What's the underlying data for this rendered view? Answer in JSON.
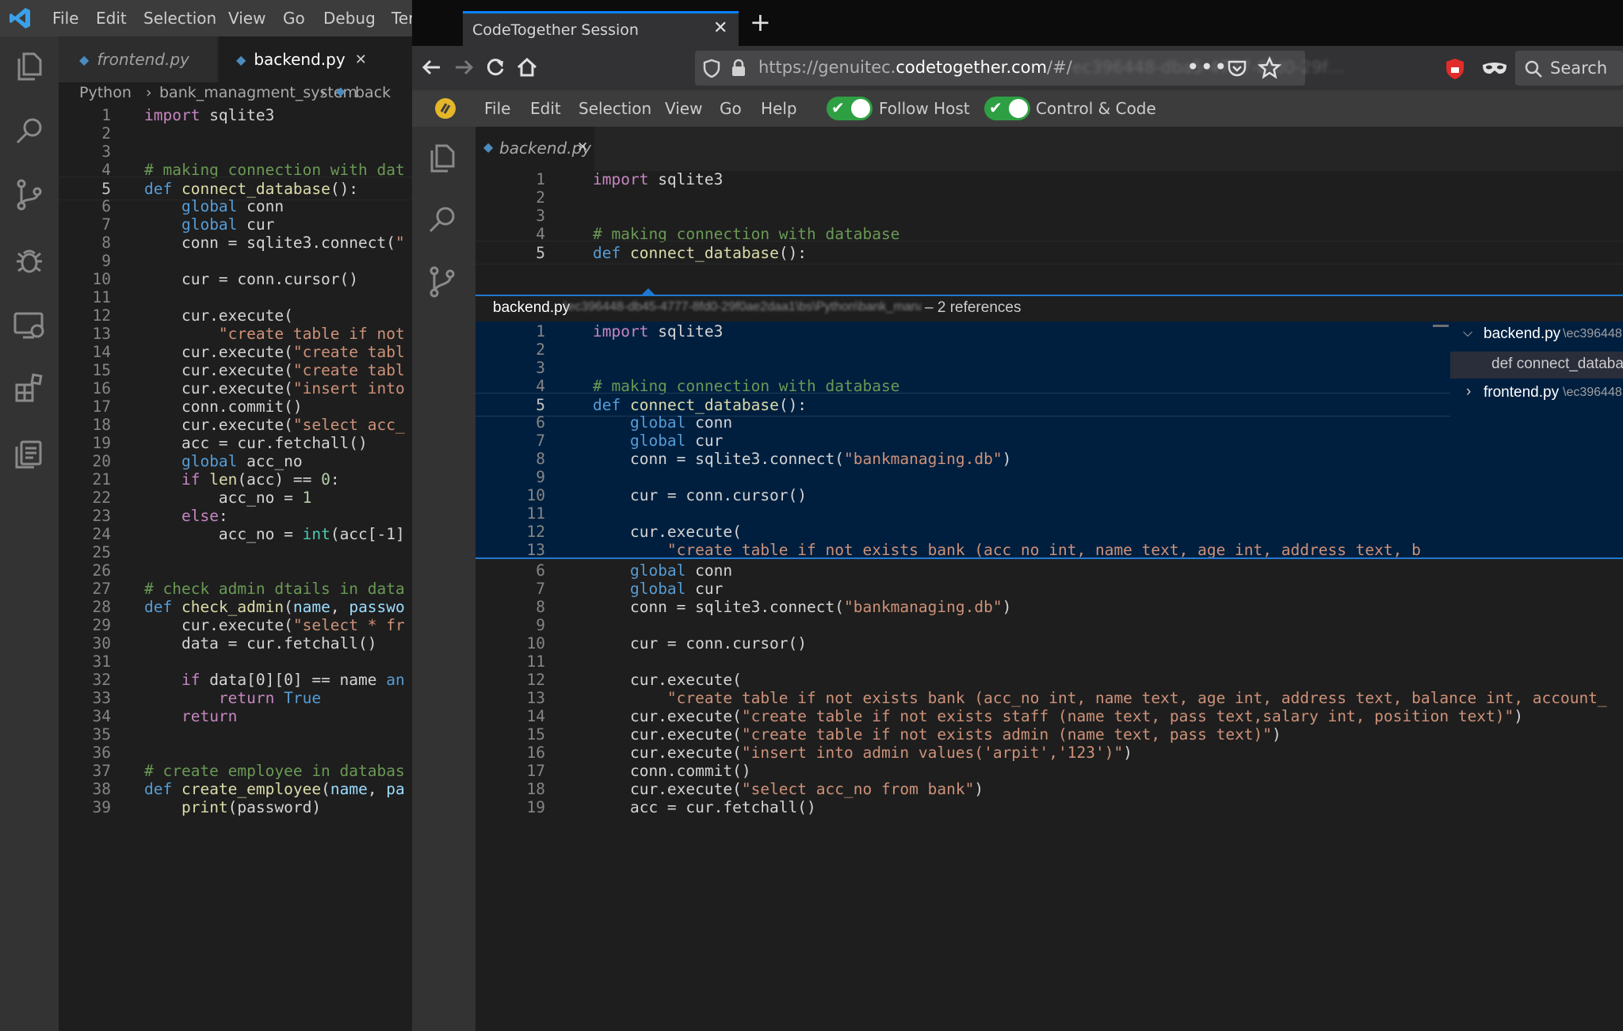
{
  "vscode": {
    "menu": [
      "File",
      "Edit",
      "Selection",
      "View",
      "Go",
      "Debug",
      "Ter"
    ],
    "tabs": [
      {
        "label": "frontend.py"
      },
      {
        "label": "backend.py"
      }
    ],
    "close_glyph": "✕",
    "breadcrumb": [
      "Python",
      "bank_managment_system",
      "back"
    ],
    "breadcrumb_sep": "›",
    "icons": [
      "files-icon",
      "search-icon",
      "source-control-icon",
      "debug-icon",
      "remote-explorer-icon",
      "extensions-icon",
      "codetogether-icon"
    ],
    "code": [
      {
        "n": "1",
        "t": [
          [
            "kc",
            "import"
          ],
          [
            "pl",
            " sqlite3"
          ]
        ]
      },
      {
        "n": "2",
        "t": []
      },
      {
        "n": "3",
        "t": []
      },
      {
        "n": "4",
        "t": [
          [
            "cm",
            "# making connection with dat"
          ]
        ]
      },
      {
        "n": "5",
        "t": [
          [
            "kw",
            "def"
          ],
          [
            "pl",
            " "
          ],
          [
            "fn",
            "connect_database"
          ],
          [
            "pl",
            "():"
          ]
        ],
        "cur": true
      },
      {
        "n": "6",
        "t": [
          [
            "pl",
            "    "
          ],
          [
            "kw",
            "global"
          ],
          [
            "pl",
            " conn"
          ]
        ]
      },
      {
        "n": "7",
        "t": [
          [
            "pl",
            "    "
          ],
          [
            "kw",
            "global"
          ],
          [
            "pl",
            " cur"
          ]
        ]
      },
      {
        "n": "8",
        "t": [
          [
            "pl",
            "    conn = sqlite3.connect("
          ],
          [
            "st",
            "\""
          ]
        ]
      },
      {
        "n": "9",
        "t": []
      },
      {
        "n": "10",
        "t": [
          [
            "pl",
            "    cur = conn.cursor()"
          ]
        ]
      },
      {
        "n": "11",
        "t": []
      },
      {
        "n": "12",
        "t": [
          [
            "pl",
            "    cur.execute("
          ]
        ]
      },
      {
        "n": "13",
        "t": [
          [
            "pl",
            "        "
          ],
          [
            "st",
            "\"create table if not"
          ]
        ]
      },
      {
        "n": "14",
        "t": [
          [
            "pl",
            "    cur.execute("
          ],
          [
            "st",
            "\"create tabl"
          ]
        ]
      },
      {
        "n": "15",
        "t": [
          [
            "pl",
            "    cur.execute("
          ],
          [
            "st",
            "\"create tabl"
          ]
        ]
      },
      {
        "n": "16",
        "t": [
          [
            "pl",
            "    cur.execute("
          ],
          [
            "st",
            "\"insert into"
          ]
        ]
      },
      {
        "n": "17",
        "t": [
          [
            "pl",
            "    conn.commit()"
          ]
        ]
      },
      {
        "n": "18",
        "t": [
          [
            "pl",
            "    cur.execute("
          ],
          [
            "st",
            "\"select acc_"
          ]
        ]
      },
      {
        "n": "19",
        "t": [
          [
            "pl",
            "    acc = cur.fetchall()"
          ]
        ]
      },
      {
        "n": "20",
        "t": [
          [
            "pl",
            "    "
          ],
          [
            "kw",
            "global"
          ],
          [
            "pl",
            " acc_no"
          ]
        ]
      },
      {
        "n": "21",
        "t": [
          [
            "pl",
            "    "
          ],
          [
            "kc",
            "if"
          ],
          [
            "pl",
            " "
          ],
          [
            "fn",
            "len"
          ],
          [
            "pl",
            "(acc) == "
          ],
          [
            "nm",
            "0"
          ],
          [
            "pl",
            ":"
          ]
        ]
      },
      {
        "n": "22",
        "t": [
          [
            "pl",
            "        acc_no = "
          ],
          [
            "nm",
            "1"
          ]
        ]
      },
      {
        "n": "23",
        "t": [
          [
            "pl",
            "    "
          ],
          [
            "kc",
            "else"
          ],
          [
            "pl",
            ":"
          ]
        ]
      },
      {
        "n": "24",
        "t": [
          [
            "pl",
            "        acc_no = "
          ],
          [
            "bi",
            "int"
          ],
          [
            "pl",
            "(acc[-1]"
          ]
        ]
      },
      {
        "n": "25",
        "t": []
      },
      {
        "n": "26",
        "t": []
      },
      {
        "n": "27",
        "t": [
          [
            "cm",
            "# check admin dtails in data"
          ]
        ]
      },
      {
        "n": "28",
        "t": [
          [
            "kw",
            "def"
          ],
          [
            "pl",
            " "
          ],
          [
            "fn",
            "check_admin"
          ],
          [
            "pl",
            "("
          ],
          [
            "pr",
            "name"
          ],
          [
            "pl",
            ", "
          ],
          [
            "pr",
            "passwo"
          ]
        ]
      },
      {
        "n": "29",
        "t": [
          [
            "pl",
            "    cur.execute("
          ],
          [
            "st",
            "\"select * fr"
          ]
        ]
      },
      {
        "n": "30",
        "t": [
          [
            "pl",
            "    data = cur.fetchall()"
          ]
        ]
      },
      {
        "n": "31",
        "t": []
      },
      {
        "n": "32",
        "t": [
          [
            "pl",
            "    "
          ],
          [
            "kc",
            "if"
          ],
          [
            "pl",
            " data[0][0] == name "
          ],
          [
            "kw",
            "an"
          ]
        ]
      },
      {
        "n": "33",
        "t": [
          [
            "pl",
            "        "
          ],
          [
            "kc",
            "return"
          ],
          [
            "pl",
            " "
          ],
          [
            "kw",
            "True"
          ]
        ]
      },
      {
        "n": "34",
        "t": [
          [
            "pl",
            "    "
          ],
          [
            "kc",
            "return"
          ]
        ]
      },
      {
        "n": "35",
        "t": []
      },
      {
        "n": "36",
        "t": []
      },
      {
        "n": "37",
        "t": [
          [
            "cm",
            "# create employee in databas"
          ]
        ]
      },
      {
        "n": "38",
        "t": [
          [
            "kw",
            "def"
          ],
          [
            "pl",
            " "
          ],
          [
            "fn",
            "create_employee"
          ],
          [
            "pl",
            "("
          ],
          [
            "pr",
            "name"
          ],
          [
            "pl",
            ", "
          ],
          [
            "pr",
            "pa"
          ]
        ]
      },
      {
        "n": "39",
        "t": [
          [
            "pl",
            "    "
          ],
          [
            "fn",
            "print"
          ],
          [
            "pl",
            "(password)"
          ]
        ]
      }
    ]
  },
  "browser": {
    "tab_title": "CodeTogether Session",
    "url_prefix": "https://genuitec.",
    "url_domain": "codetogether.com",
    "url_path": "/#/",
    "url_hidden": "ec396448-dba5-4777-8fd0-29f…",
    "search_placeholder": "Search",
    "new_tab": "+"
  },
  "app": {
    "menu": [
      "File",
      "Edit",
      "Selection",
      "View",
      "Go",
      "Help"
    ],
    "toggles": [
      {
        "label": "Follow Host",
        "on": true
      },
      {
        "label": "Control & Code",
        "on": true
      }
    ],
    "tab": {
      "label": "backend.py"
    },
    "top_code": [
      {
        "n": "1",
        "t": [
          [
            "kc",
            "import"
          ],
          [
            "pl",
            " sqlite3"
          ]
        ]
      },
      {
        "n": "2",
        "t": []
      },
      {
        "n": "3",
        "t": []
      },
      {
        "n": "4",
        "t": [
          [
            "cm",
            "# making connection with database"
          ]
        ]
      },
      {
        "n": "5",
        "t": [
          [
            "kw",
            "def"
          ],
          [
            "pl",
            " "
          ],
          [
            "fn",
            "connect_database"
          ],
          [
            "pl",
            "():"
          ]
        ],
        "cur": true
      }
    ],
    "peek": {
      "file": "backend.py",
      "path": "\\ec396448-db45-4777-8fd0-29f0ae2daa1\\bs\\Python\\bank_managment_system",
      "refs": "– 2 references",
      "tree": [
        {
          "label": "backend.py",
          "detail": "\\ec396448",
          "expanded": true
        },
        {
          "label": "def connect_databa",
          "child": true
        },
        {
          "label": "frontend.py",
          "detail": "\\ec396448",
          "expanded": false
        }
      ],
      "code": [
        {
          "n": "1",
          "t": [
            [
              "kc",
              "import"
            ],
            [
              "pl",
              " sqlite3"
            ]
          ]
        },
        {
          "n": "2",
          "t": []
        },
        {
          "n": "3",
          "t": []
        },
        {
          "n": "4",
          "t": [
            [
              "cm",
              "# making connection with database"
            ]
          ]
        },
        {
          "n": "5",
          "t": [
            [
              "kw",
              "def"
            ],
            [
              "pl",
              " "
            ],
            [
              "fn",
              "connect_database"
            ],
            [
              "pl",
              "():"
            ]
          ],
          "cur": true
        },
        {
          "n": "6",
          "t": [
            [
              "pl",
              "    "
            ],
            [
              "kw",
              "global"
            ],
            [
              "pl",
              " conn"
            ]
          ]
        },
        {
          "n": "7",
          "t": [
            [
              "pl",
              "    "
            ],
            [
              "kw",
              "global"
            ],
            [
              "pl",
              " cur"
            ]
          ]
        },
        {
          "n": "8",
          "t": [
            [
              "pl",
              "    conn = sqlite3.connect("
            ],
            [
              "st",
              "\"bankmanaging.db\""
            ],
            [
              "pl",
              ")"
            ]
          ]
        },
        {
          "n": "9",
          "t": []
        },
        {
          "n": "10",
          "t": [
            [
              "pl",
              "    cur = conn.cursor()"
            ]
          ]
        },
        {
          "n": "11",
          "t": []
        },
        {
          "n": "12",
          "t": [
            [
              "pl",
              "    cur.execute("
            ]
          ]
        },
        {
          "n": "13",
          "t": [
            [
              "pl",
              "        "
            ],
            [
              "st",
              "\"create table if not exists bank (acc_no int, name text, age int, address text, b"
            ]
          ]
        },
        {
          "n": "14",
          "t": [
            [
              "pl",
              "    cur.execute("
            ],
            [
              "st",
              "\"create table if not exists staff (name text, pass text,salary int, posit"
            ]
          ]
        },
        {
          "n": "15",
          "t": [
            [
              "pl",
              "    cur.execute("
            ],
            [
              "st",
              "\"create table if not exists admin (name text, pass text)\""
            ],
            [
              "pl",
              ")"
            ]
          ]
        },
        {
          "n": "16",
          "t": [
            [
              "pl",
              "    cur.execute("
            ],
            [
              "st",
              "\"insert into admin values('arpit','123')\""
            ],
            [
              "pl",
              ")"
            ]
          ]
        }
      ]
    },
    "lower_code": [
      {
        "n": "6",
        "t": [
          [
            "pl",
            "    "
          ],
          [
            "kw",
            "global"
          ],
          [
            "pl",
            " conn"
          ]
        ]
      },
      {
        "n": "7",
        "t": [
          [
            "pl",
            "    "
          ],
          [
            "kw",
            "global"
          ],
          [
            "pl",
            " cur"
          ]
        ]
      },
      {
        "n": "8",
        "t": [
          [
            "pl",
            "    conn = sqlite3.connect("
          ],
          [
            "st",
            "\"bankmanaging.db\""
          ],
          [
            "pl",
            ")"
          ]
        ]
      },
      {
        "n": "9",
        "t": []
      },
      {
        "n": "10",
        "t": [
          [
            "pl",
            "    cur = conn.cursor()"
          ]
        ]
      },
      {
        "n": "11",
        "t": []
      },
      {
        "n": "12",
        "t": [
          [
            "pl",
            "    cur.execute("
          ]
        ]
      },
      {
        "n": "13",
        "t": [
          [
            "pl",
            "        "
          ],
          [
            "st",
            "\"create table if not exists bank (acc_no int, name text, age int, address text, balance int, account_"
          ]
        ]
      },
      {
        "n": "14",
        "t": [
          [
            "pl",
            "    cur.execute("
          ],
          [
            "st",
            "\"create table if not exists staff (name text, pass text,salary int, position text)\""
          ],
          [
            "pl",
            ")"
          ]
        ]
      },
      {
        "n": "15",
        "t": [
          [
            "pl",
            "    cur.execute("
          ],
          [
            "st",
            "\"create table if not exists admin (name text, pass text)\""
          ],
          [
            "pl",
            ")"
          ]
        ]
      },
      {
        "n": "16",
        "t": [
          [
            "pl",
            "    cur.execute("
          ],
          [
            "st",
            "\"insert into admin values('arpit','123')\""
          ],
          [
            "pl",
            ")"
          ]
        ]
      },
      {
        "n": "17",
        "t": [
          [
            "pl",
            "    conn.commit()"
          ]
        ]
      },
      {
        "n": "18",
        "t": [
          [
            "pl",
            "    cur.execute("
          ],
          [
            "st",
            "\"select acc_no from bank\""
          ],
          [
            "pl",
            ")"
          ]
        ]
      },
      {
        "n": "19",
        "t": [
          [
            "pl",
            "    acc = cur.fetchall()"
          ]
        ]
      }
    ]
  },
  "colors": {
    "accent_blue": "#1f78d1",
    "toggle_green": "#2ea043",
    "peek_bg": "#001f3f",
    "vscode_blue": "#007acc"
  }
}
